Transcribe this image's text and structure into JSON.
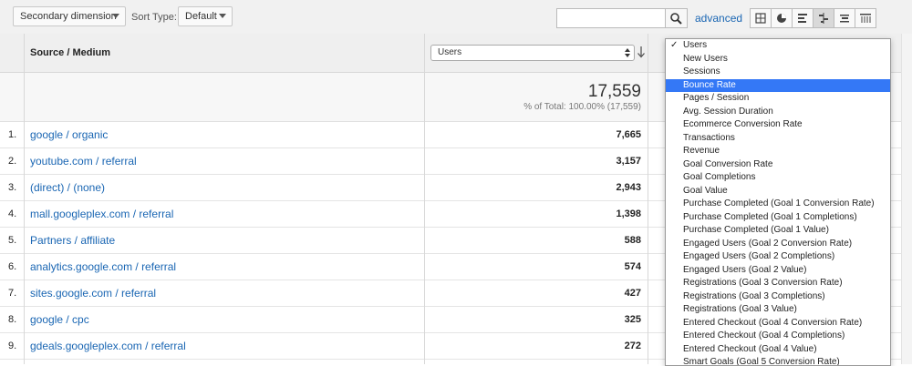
{
  "toolbar": {
    "secondary_dimension": "Secondary dimension",
    "sort_type_label": "Sort Type:",
    "sort_type_value": "Default",
    "search_value": "",
    "advanced_link": "advanced"
  },
  "table": {
    "header_source": "Source / Medium",
    "header_metric": "Users",
    "total_value": "17,559",
    "total_pct": "% of Total: 100.00% (17,559)",
    "rows": [
      {
        "num": "1.",
        "source": "google / organic",
        "users": "7,665"
      },
      {
        "num": "2.",
        "source": "youtube.com / referral",
        "users": "3,157"
      },
      {
        "num": "3.",
        "source": "(direct) / (none)",
        "users": "2,943"
      },
      {
        "num": "4.",
        "source": "mall.googleplex.com / referral",
        "users": "1,398"
      },
      {
        "num": "5.",
        "source": "Partners / affiliate",
        "users": "588"
      },
      {
        "num": "6.",
        "source": "analytics.google.com / referral",
        "users": "574"
      },
      {
        "num": "7.",
        "source": "sites.google.com / referral",
        "users": "427"
      },
      {
        "num": "8.",
        "source": "google / cpc",
        "users": "325"
      },
      {
        "num": "9.",
        "source": "gdeals.googleplex.com / referral",
        "users": "272"
      }
    ]
  },
  "dropdown": {
    "selected_index": 0,
    "highlighted_index": 3,
    "items": [
      "Users",
      "New Users",
      "Sessions",
      "Bounce Rate",
      "Pages / Session",
      "Avg. Session Duration",
      "Ecommerce Conversion Rate",
      "Transactions",
      "Revenue",
      "Goal Conversion Rate",
      "Goal Completions",
      "Goal Value",
      "Purchase Completed (Goal 1 Conversion Rate)",
      "Purchase Completed (Goal 1 Completions)",
      "Purchase Completed (Goal 1 Value)",
      "Engaged Users (Goal 2 Conversion Rate)",
      "Engaged Users (Goal 2 Completions)",
      "Engaged Users (Goal 2 Value)",
      "Registrations (Goal 3 Conversion Rate)",
      "Registrations (Goal 3 Completions)",
      "Registrations (Goal 3 Value)",
      "Entered Checkout (Goal 4 Conversion Rate)",
      "Entered Checkout (Goal 4 Completions)",
      "Entered Checkout (Goal 4 Value)",
      "Smart Goals (Goal 5 Conversion Rate)"
    ]
  },
  "colors": {
    "link": "#1a66b3",
    "highlight": "#3478f6"
  }
}
